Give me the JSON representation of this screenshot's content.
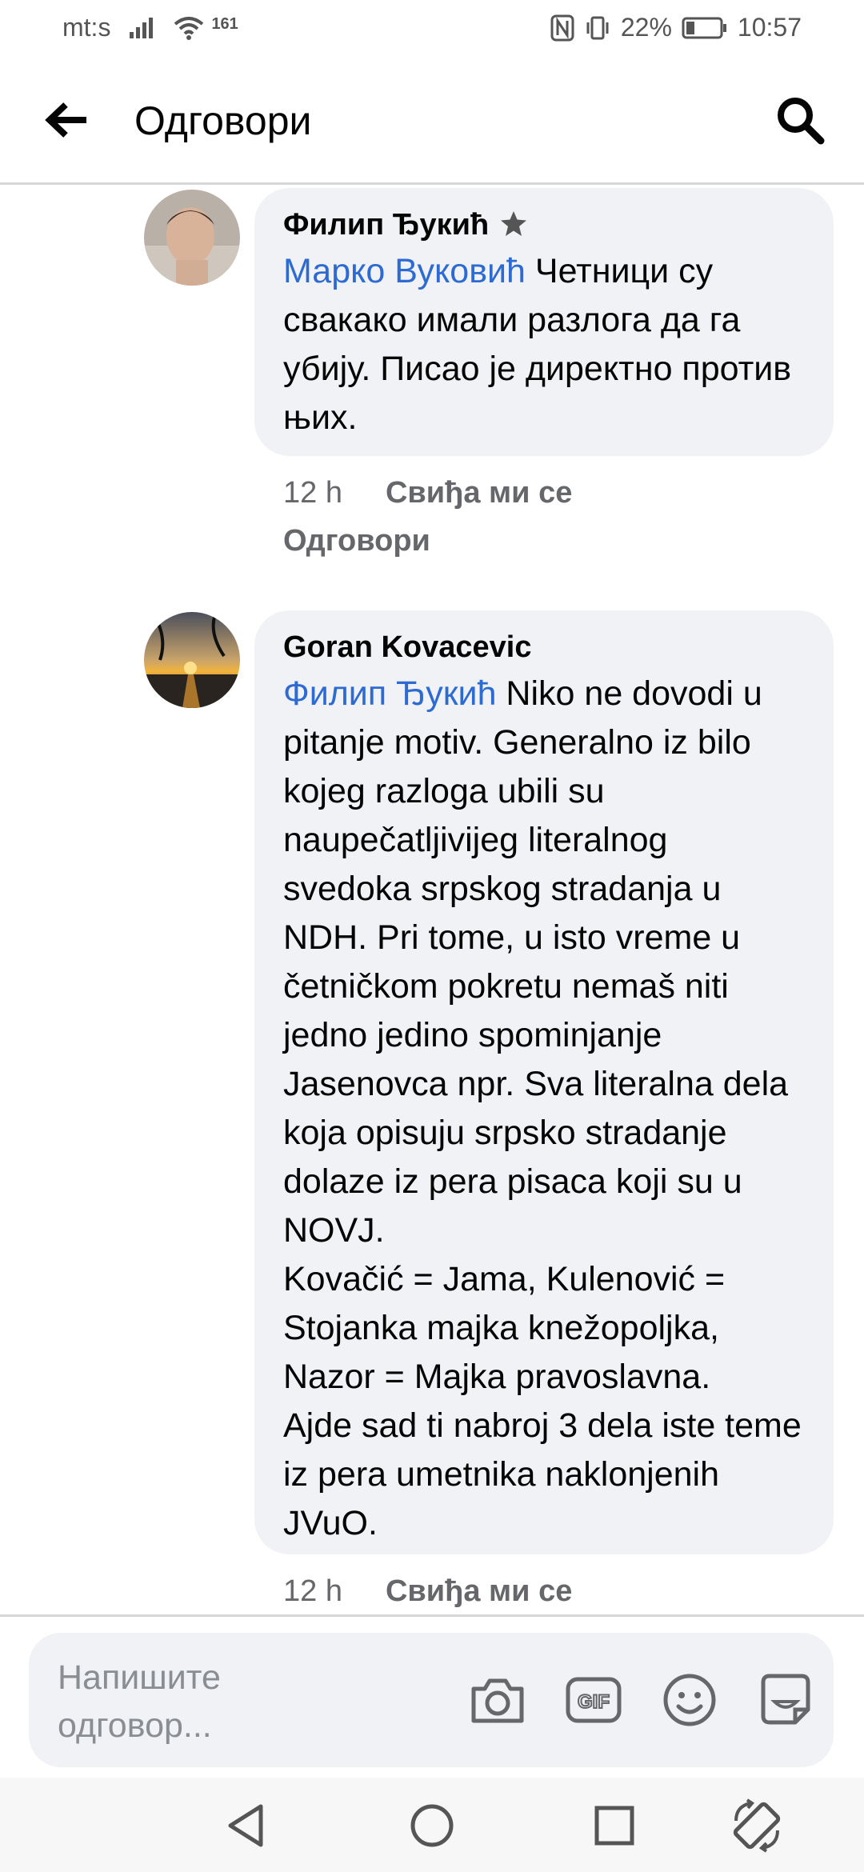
{
  "status_bar": {
    "carrier": "mt:s",
    "signal_extra": "161",
    "battery_percent": "22%",
    "time": "10:57"
  },
  "header": {
    "title": "Одговори"
  },
  "comments": [
    {
      "author": "Филип Ђукић",
      "badge": "star-badge-icon",
      "mention": "Марко Вуковић",
      "text": " Четници су свакако имали разлога да га убију. Писао је директно против њих.",
      "time": "12 h",
      "like": "Свиђа ми се",
      "reply": "Одговори"
    },
    {
      "author": "Goran Kovacevic",
      "mention": "Филип Ђукић",
      "text": " Niko ne dovodi u pitanje motiv. Generalno iz bilo kojeg razloga ubili su naupečatljivijeg literalnog svedoka srpskog stradanja u NDH. Pri tome, u isto vreme u četničkom pokretu nemaš niti jedno jedino spominjanje Jasenovca npr. Sva literalna dela koja opisuju srpsko stradanje dolaze iz pera pisaca koji su u NOVJ.\nKovačić = Jama, Kulenović = Stojanka majka knežopoljka, Nazor = Majka pravoslavna.\nAjde sad ti nabroj 3 dela iste teme iz pera umetnika naklonjenih JVuO.",
      "time": "12 h",
      "like": "Свиђа ми се"
    }
  ],
  "composer": {
    "placeholder": "Напишите\nодговор...",
    "icons": [
      "camera-icon",
      "gif-icon",
      "emoji-icon",
      "sticker-icon"
    ]
  },
  "navbar": {
    "icons": [
      "back-triangle-icon",
      "home-circle-icon",
      "recents-square-icon",
      "rotate-icon"
    ]
  },
  "colors": {
    "mention": "#2d6ad1",
    "bubble": "#f0f2f5",
    "meta_text": "#65676b"
  }
}
